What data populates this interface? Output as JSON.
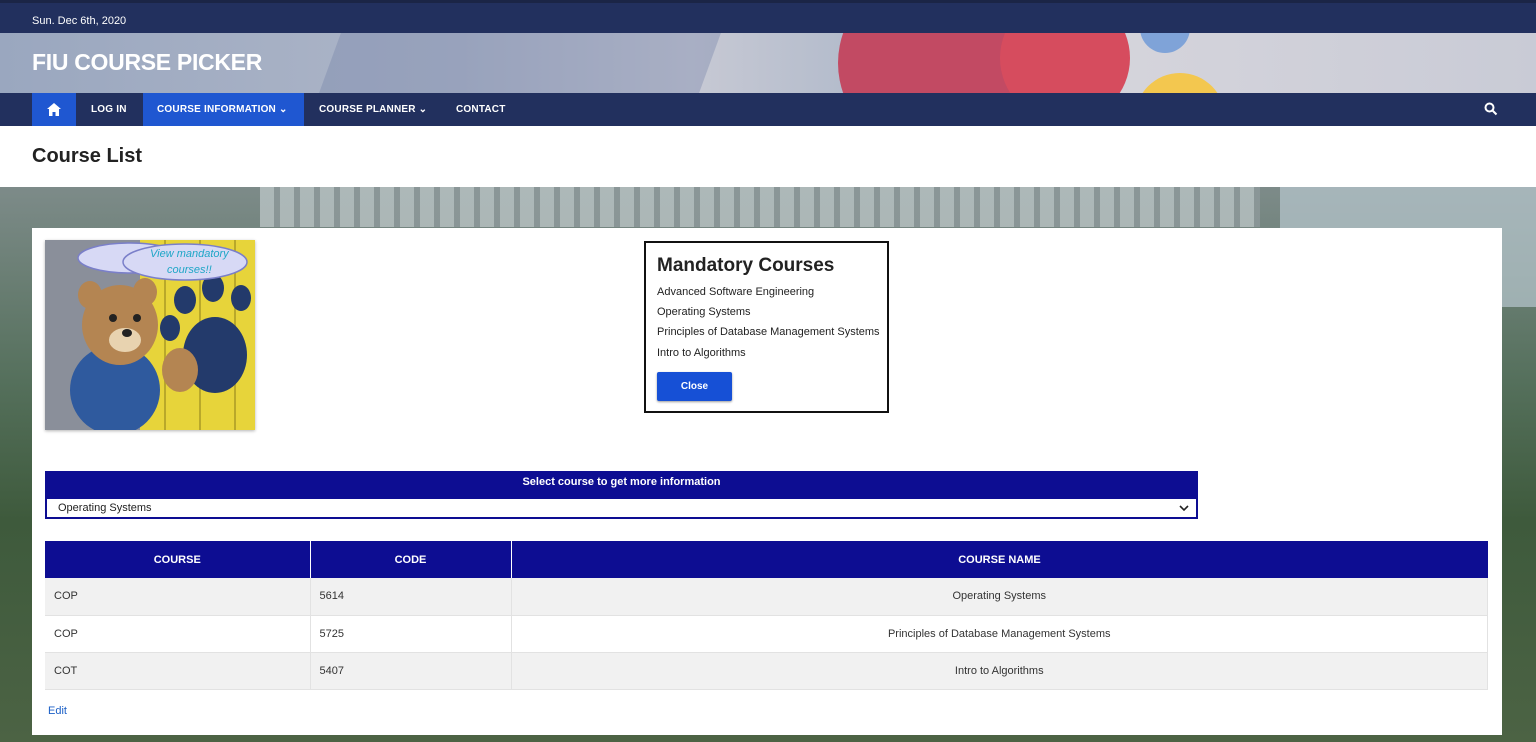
{
  "topbar": {
    "date": "Sun. Dec 6th, 2020"
  },
  "site": {
    "title": "FIU COURSE PICKER"
  },
  "nav": {
    "home_icon": "home-icon",
    "items": [
      {
        "label": "LOG IN"
      },
      {
        "label": "COURSE INFORMATION ⌄"
      },
      {
        "label": "COURSE PLANNER ⌄"
      },
      {
        "label": "CONTACT"
      }
    ],
    "search_icon": "search-icon"
  },
  "page": {
    "title": "Course List"
  },
  "mascot": {
    "bubble_text": "View mandatory courses!!"
  },
  "modal": {
    "title": "Mandatory Courses",
    "courses": [
      "Advanced Software Engineering",
      "Operating Systems",
      "Principles of Database Management Systems",
      "Intro to Algorithms"
    ],
    "close_label": "Close"
  },
  "selector": {
    "header": "Select course to get more information",
    "selected": "Operating Systems"
  },
  "table": {
    "headers": [
      "COURSE",
      "CODE",
      "COURSE NAME"
    ],
    "rows": [
      {
        "course": "COP",
        "code": "5614",
        "name": "Operating Systems"
      },
      {
        "course": "COP",
        "code": "5725",
        "name": "Principles of Database Management Systems"
      },
      {
        "course": "COT",
        "code": "5407",
        "name": "Intro to Algorithms"
      }
    ]
  },
  "edit_label": "Edit",
  "colors": {
    "nav": "#22305e",
    "accent": "#1f57d1",
    "table_header": "#0d0d92"
  }
}
